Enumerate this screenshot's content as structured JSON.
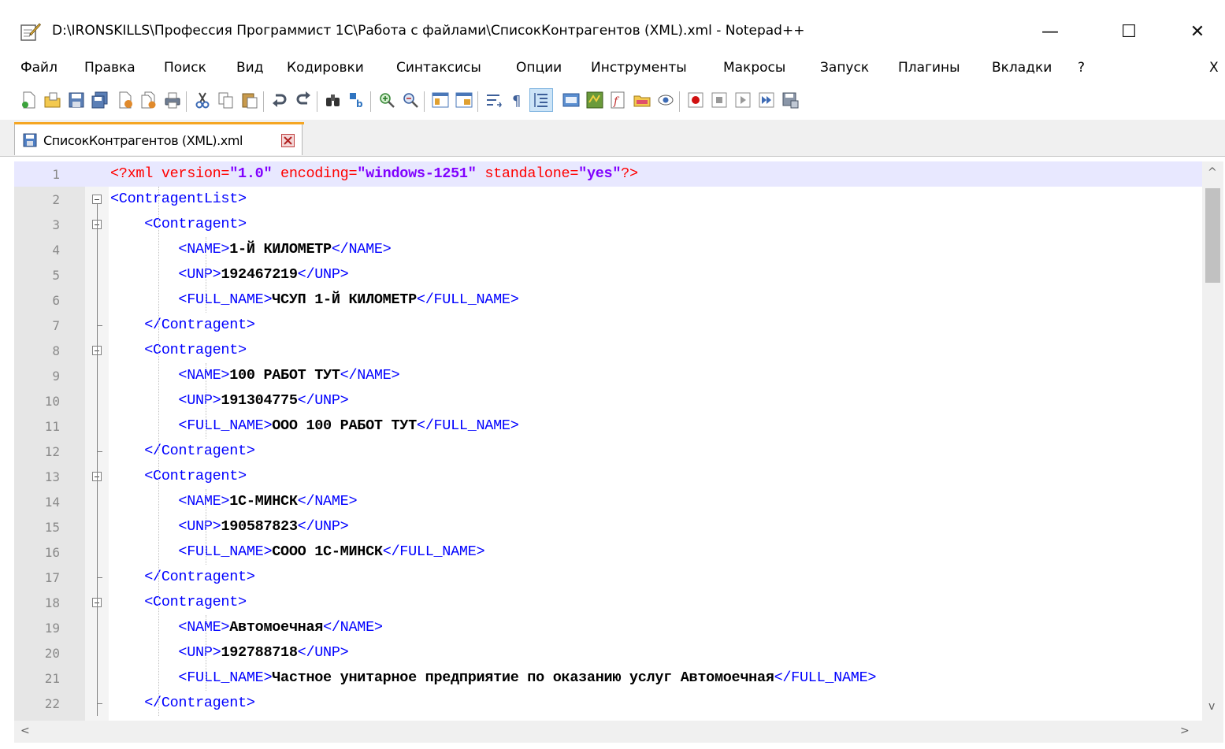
{
  "window": {
    "title": "D:\\IRONSKILLS\\Профессия Программист 1С\\Работа с файлами\\СписокКонтрагентов (XML).xml - Notepad++",
    "minimize": "—",
    "maximize": "☐",
    "close": "✕"
  },
  "menu": {
    "items": [
      "Файл",
      "Правка",
      "Поиск",
      "Вид",
      "Кодировки",
      "Синтаксисы",
      "Опции",
      "Инструменты",
      "Макросы",
      "Запуск",
      "Плагины",
      "Вкладки",
      "?"
    ],
    "close_doc": "X"
  },
  "toolbar": {
    "icons": [
      "new-file-icon",
      "open-file-icon",
      "save-icon",
      "save-all-icon",
      "close-icon",
      "close-all-icon",
      "print-icon",
      "cut-icon",
      "copy-icon",
      "paste-icon",
      "undo-icon",
      "redo-icon",
      "find-icon",
      "replace-icon",
      "zoom-in-icon",
      "zoom-out-icon",
      "sync-vertical-icon",
      "sync-horizontal-icon",
      "word-wrap-icon",
      "show-all-chars-icon",
      "indent-guide-icon",
      "user-language-icon",
      "document-map-icon",
      "function-list-icon",
      "folder-workspace-icon",
      "monitoring-icon",
      "record-macro-icon",
      "stop-record-icon",
      "play-macro-icon",
      "run-macro-multiple-icon",
      "save-macro-icon"
    ]
  },
  "tab": {
    "label": "СписокКонтрагентов (XML).xml"
  },
  "editor": {
    "colors": {
      "tag": "#0000ff",
      "attr": "#ff0000",
      "value": "#8000ff",
      "text": "#000000",
      "current_line": "#e8e8ff"
    },
    "lines": [
      {
        "n": "1",
        "ind": "",
        "tag": "",
        "text": "",
        "pi": "<?xml ",
        "a1": "version=",
        "v1": "\"1.0\"",
        "a2": " encoding=",
        "v2": "\"windows-1251\"",
        "a3": " standalone=",
        "v3": "\"yes\"",
        "piend": "?>"
      },
      {
        "n": "2",
        "ind": "",
        "tag": "<ContragentList>",
        "text": "",
        "close": ""
      },
      {
        "n": "3",
        "ind": "    ",
        "tag": "<Contragent>",
        "text": "",
        "close": ""
      },
      {
        "n": "4",
        "ind": "        ",
        "tag": "<NAME>",
        "text": "1-Й КИЛОМЕТР",
        "close": "</NAME>"
      },
      {
        "n": "5",
        "ind": "        ",
        "tag": "<UNP>",
        "text": "192467219",
        "close": "</UNP>"
      },
      {
        "n": "6",
        "ind": "        ",
        "tag": "<FULL_NAME>",
        "text": "ЧСУП 1-Й КИЛОМЕТР",
        "close": "</FULL_NAME>"
      },
      {
        "n": "7",
        "ind": "    ",
        "tag": "</Contragent>",
        "text": "",
        "close": ""
      },
      {
        "n": "8",
        "ind": "    ",
        "tag": "<Contragent>",
        "text": "",
        "close": ""
      },
      {
        "n": "9",
        "ind": "        ",
        "tag": "<NAME>",
        "text": "100 РАБОТ ТУТ",
        "close": "</NAME>"
      },
      {
        "n": "10",
        "ind": "        ",
        "tag": "<UNP>",
        "text": "191304775",
        "close": "</UNP>"
      },
      {
        "n": "11",
        "ind": "        ",
        "tag": "<FULL_NAME>",
        "text": "ООО 100 РАБОТ ТУТ",
        "close": "</FULL_NAME>"
      },
      {
        "n": "12",
        "ind": "    ",
        "tag": "</Contragent>",
        "text": "",
        "close": ""
      },
      {
        "n": "13",
        "ind": "    ",
        "tag": "<Contragent>",
        "text": "",
        "close": ""
      },
      {
        "n": "14",
        "ind": "        ",
        "tag": "<NAME>",
        "text": "1С-МИНСК",
        "close": "</NAME>"
      },
      {
        "n": "15",
        "ind": "        ",
        "tag": "<UNP>",
        "text": "190587823",
        "close": "</UNP>"
      },
      {
        "n": "16",
        "ind": "        ",
        "tag": "<FULL_NAME>",
        "text": "СООО 1С-МИНСК",
        "close": "</FULL_NAME>"
      },
      {
        "n": "17",
        "ind": "    ",
        "tag": "</Contragent>",
        "text": "",
        "close": ""
      },
      {
        "n": "18",
        "ind": "    ",
        "tag": "<Contragent>",
        "text": "",
        "close": ""
      },
      {
        "n": "19",
        "ind": "        ",
        "tag": "<NAME>",
        "text": "Автомоечная",
        "close": "</NAME>"
      },
      {
        "n": "20",
        "ind": "        ",
        "tag": "<UNP>",
        "text": "192788718",
        "close": "</UNP>"
      },
      {
        "n": "21",
        "ind": "        ",
        "tag": "<FULL_NAME>",
        "text": "Частное унитарное предприятие по оказанию услуг Автомоечная",
        "close": "</FULL_NAME>"
      },
      {
        "n": "22",
        "ind": "    ",
        "tag": "</Contragent>",
        "text": "",
        "close": ""
      }
    ]
  },
  "scroll": {
    "left": "<",
    "right": ">",
    "up": "^",
    "down": "v"
  }
}
